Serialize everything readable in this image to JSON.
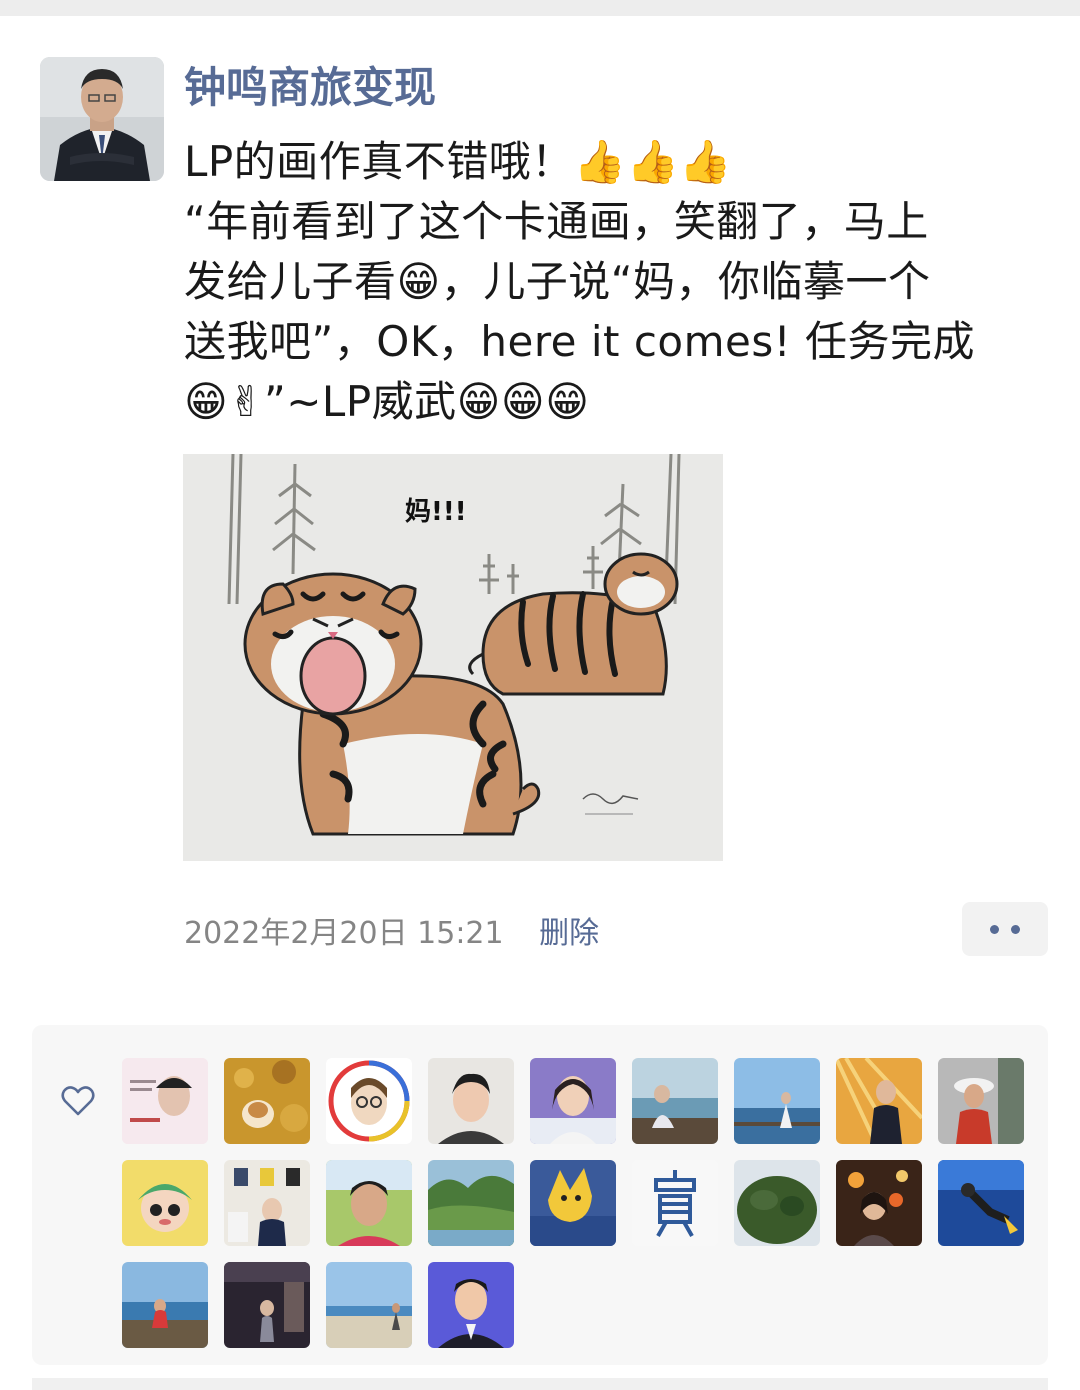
{
  "post": {
    "author": "钟鸣商旅变现",
    "content_lines": [
      "LP的画作真不错哦！👍👍👍",
      "“年前看到了这个卡通画，笑翻了，马上",
      "发给儿子看😁，儿子说“妈，你临摹一个",
      "送我吧”，OK，here it comes! 任务完成",
      "😁✌”~LP威武😁😁😁"
    ],
    "image_text": "妈!!!",
    "timestamp": "2022年2月20日 15:21",
    "delete_label": "删除"
  },
  "icons": {
    "more": "more-dots-icon",
    "like": "heart-icon"
  },
  "colors": {
    "link": "#576b95",
    "meta": "#858585",
    "likes_bg": "#f7f7f7"
  }
}
